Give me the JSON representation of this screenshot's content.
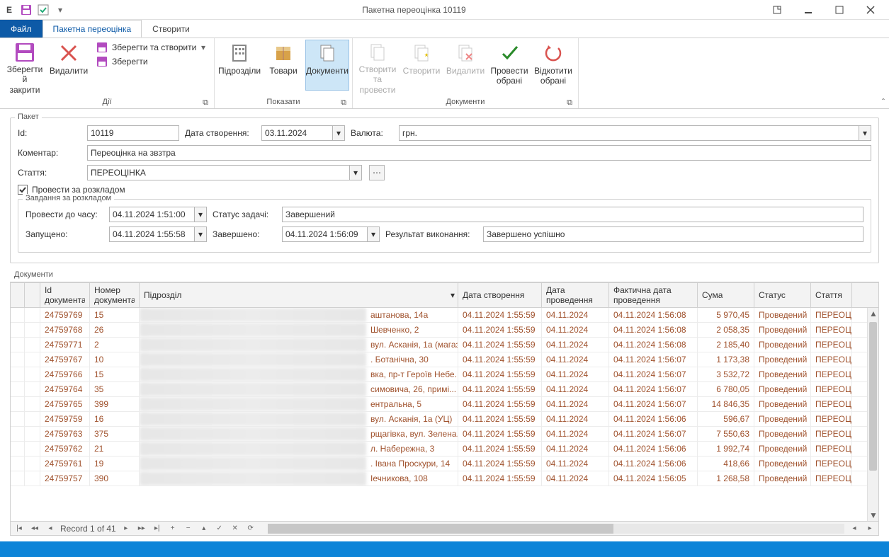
{
  "window": {
    "title": "Пакетна переоцінка 10119"
  },
  "qat": {
    "app_letter": "E"
  },
  "tabs": {
    "file": "Файл",
    "main": "Пакетна переоцінка",
    "create": "Створити"
  },
  "ribbon": {
    "save_close": "Зберегти\nй закрити",
    "delete": "Видалити",
    "save_create": "Зберегти та створити",
    "save": "Зберегти",
    "actions_group": "Дії",
    "divisions": "Підрозділи",
    "goods": "Товари",
    "documents_btn": "Документи",
    "show_group": "Показати",
    "create_run": "Створити та\nпровести",
    "create_one": "Створити",
    "delete_one": "Видалити",
    "run_selected": "Провести\nобрані",
    "rollback_selected": "Відкотити\nобрані",
    "docs_group": "Документи"
  },
  "pkg": {
    "legend": "Пакет",
    "id_label": "Id:",
    "id_value": "10119",
    "date_label": "Дата створення:",
    "date_value": "03.11.2024",
    "curr_label": "Валюта:",
    "curr_value": "грн.",
    "comment_label": "Коментар:",
    "comment_value": "Переоцінка на звзтра",
    "article_label": "Стаття:",
    "article_value": "ПЕРЕОЦІНКА",
    "cb_label": "Провести за розкладом"
  },
  "task": {
    "legend": "Завдання за розкладом",
    "run_until_label": "Провести до часу:",
    "run_until_value": "04.11.2024 1:51:00",
    "status_label": "Статус задачі:",
    "status_value": "Завершений",
    "started_label": "Запущено:",
    "started_value": "04.11.2024 1:55:58",
    "finished_label": "Завершено:",
    "finished_value": "04.11.2024 1:56:09",
    "result_label": "Результат виконання:",
    "result_value": "Завершено успішно"
  },
  "docs": {
    "legend": "Документи",
    "headers": {
      "id": "Id\nдокумента",
      "num": "Номер\nдокумента",
      "div": "Підрозділ",
      "created": "Дата створення",
      "date_run": "Дата\nпроведення",
      "fact_date": "Фактична дата\nпроведення",
      "sum": "Сума",
      "status": "Статус",
      "article": "Стаття"
    },
    "rows": [
      {
        "id": "24759769",
        "num": "15",
        "div": "аштанова, 14а",
        "created": "04.11.2024 1:55:59",
        "date": "04.11.2024",
        "fact": "04.11.2024 1:56:08",
        "sum": "5 970,45",
        "status": "Проведений",
        "art": "ПЕРЕОЦІН"
      },
      {
        "id": "24759768",
        "num": "26",
        "div": "Шевченко, 2",
        "created": "04.11.2024 1:55:59",
        "date": "04.11.2024",
        "fact": "04.11.2024 1:56:08",
        "sum": "2 058,35",
        "status": "Проведений",
        "art": "ПЕРЕОЦІН"
      },
      {
        "id": "24759771",
        "num": "2",
        "div": "вул. Асканія, 1а (магаз...",
        "created": "04.11.2024 1:55:59",
        "date": "04.11.2024",
        "fact": "04.11.2024 1:56:08",
        "sum": "2 185,40",
        "status": "Проведений",
        "art": "ПЕРЕОЦІН"
      },
      {
        "id": "24759767",
        "num": "10",
        "div": ". Ботанічна, 30",
        "created": "04.11.2024 1:55:59",
        "date": "04.11.2024",
        "fact": "04.11.2024 1:56:07",
        "sum": "1 173,38",
        "status": "Проведений",
        "art": "ПЕРЕОЦІН"
      },
      {
        "id": "24759766",
        "num": "15",
        "div": "вка, пр-т Героїв Небе...",
        "created": "04.11.2024 1:55:59",
        "date": "04.11.2024",
        "fact": "04.11.2024 1:56:07",
        "sum": "3 532,72",
        "status": "Проведений",
        "art": "ПЕРЕОЦІН"
      },
      {
        "id": "24759764",
        "num": "35",
        "div": "симовича, 26, примі...",
        "created": "04.11.2024 1:55:59",
        "date": "04.11.2024",
        "fact": "04.11.2024 1:56:07",
        "sum": "6 780,05",
        "status": "Проведений",
        "art": "ПЕРЕОЦІН"
      },
      {
        "id": "24759765",
        "num": "399",
        "div": "ентральна, 5",
        "created": "04.11.2024 1:55:59",
        "date": "04.11.2024",
        "fact": "04.11.2024 1:56:07",
        "sum": "14 846,35",
        "status": "Проведений",
        "art": "ПЕРЕОЦІН"
      },
      {
        "id": "24759759",
        "num": "16",
        "div": "вул. Асканія, 1а (УЦ)",
        "created": "04.11.2024 1:55:59",
        "date": "04.11.2024",
        "fact": "04.11.2024 1:56:06",
        "sum": "596,67",
        "status": "Проведений",
        "art": "ПЕРЕОЦІН"
      },
      {
        "id": "24759763",
        "num": "375",
        "div": "рщагівка, вул. Зелена...",
        "created": "04.11.2024 1:55:59",
        "date": "04.11.2024",
        "fact": "04.11.2024 1:56:07",
        "sum": "7 550,63",
        "status": "Проведений",
        "art": "ПЕРЕОЦІН"
      },
      {
        "id": "24759762",
        "num": "21",
        "div": "л. Набережна, 3",
        "created": "04.11.2024 1:55:59",
        "date": "04.11.2024",
        "fact": "04.11.2024 1:56:06",
        "sum": "1 992,74",
        "status": "Проведений",
        "art": "ПЕРЕОЦІН"
      },
      {
        "id": "24759761",
        "num": "19",
        "div": ". Івана Проскури, 14",
        "created": "04.11.2024 1:55:59",
        "date": "04.11.2024",
        "fact": "04.11.2024 1:56:06",
        "sum": "418,66",
        "status": "Проведений",
        "art": "ПЕРЕОЦІН"
      },
      {
        "id": "24759757",
        "num": "390",
        "div": "Іечникова, 108",
        "created": "04.11.2024 1:55:59",
        "date": "04.11.2024",
        "fact": "04.11.2024 1:56:05",
        "sum": "1 268,58",
        "status": "Проведений",
        "art": "ПЕРЕОЦІН"
      }
    ],
    "nav": "Record 1 of 41"
  }
}
